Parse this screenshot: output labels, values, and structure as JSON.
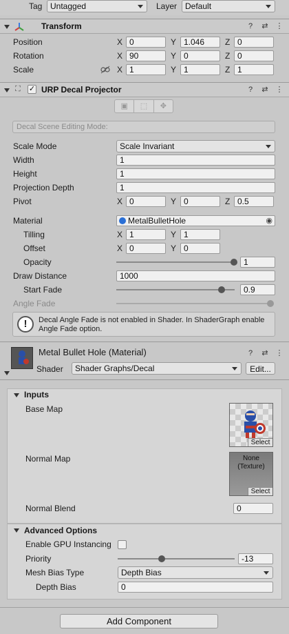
{
  "top": {
    "tag_label": "Tag",
    "tag_value": "Untagged",
    "layer_label": "Layer",
    "layer_value": "Default"
  },
  "transform": {
    "title": "Transform",
    "position": {
      "label": "Position",
      "x": "0",
      "y": "1.046",
      "z": "0"
    },
    "rotation": {
      "label": "Rotation",
      "x": "90",
      "y": "0",
      "z": "0"
    },
    "scale": {
      "label": "Scale",
      "x": "1",
      "y": "1",
      "z": "1"
    },
    "axis_x": "X",
    "axis_y": "Y",
    "axis_z": "Z"
  },
  "decal": {
    "title": "URP Decal Projector",
    "editing_mode_label": "Decal Scene Editing Mode:",
    "scale_mode": {
      "label": "Scale Mode",
      "value": "Scale Invariant"
    },
    "width": {
      "label": "Width",
      "value": "1"
    },
    "height": {
      "label": "Height",
      "value": "1"
    },
    "projection_depth": {
      "label": "Projection Depth",
      "value": "1"
    },
    "pivot": {
      "label": "Pivot",
      "x": "0",
      "y": "0",
      "z": "0.5"
    },
    "material": {
      "label": "Material",
      "value": "MetalBulletHole"
    },
    "tilling": {
      "label": "Tilling",
      "x": "1",
      "y": "1"
    },
    "offset": {
      "label": "Offset",
      "x": "0",
      "y": "0"
    },
    "opacity": {
      "label": "Opacity",
      "value": "1",
      "level": 1.0
    },
    "draw_distance": {
      "label": "Draw Distance",
      "value": "1000"
    },
    "start_fade": {
      "label": "Start Fade",
      "value": "0.9",
      "level": 0.9
    },
    "angle_fade": {
      "label": "Angle Fade"
    },
    "help_text": "Decal Angle Fade is not enabled in Shader. In ShaderGraph enable Angle Fade option."
  },
  "material_panel": {
    "title": "Metal Bullet Hole (Material)",
    "shader_label": "Shader",
    "shader_value": "Shader Graphs/Decal",
    "edit_button": "Edit..."
  },
  "inputs": {
    "title": "Inputs",
    "base_map_label": "Base Map",
    "normal_map_label": "Normal Map",
    "normal_map_none": "None",
    "normal_map_type": "(Texture)",
    "select_label": "Select",
    "normal_blend": {
      "label": "Normal Blend",
      "value": "0"
    }
  },
  "advanced": {
    "title": "Advanced Options",
    "gpu_instancing_label": "Enable GPU Instancing",
    "priority": {
      "label": "Priority",
      "value": "-13",
      "min": -50,
      "max": 50
    },
    "mesh_bias_type": {
      "label": "Mesh Bias Type",
      "value": "Depth Bias"
    },
    "depth_bias": {
      "label": "Depth Bias",
      "value": "0"
    }
  },
  "add_component": "Add Component",
  "colors": {
    "panel": "#c8c8c8",
    "field": "#f0f0f0",
    "material_blue": "#2a6fd6",
    "shield_red": "#c0392b"
  }
}
